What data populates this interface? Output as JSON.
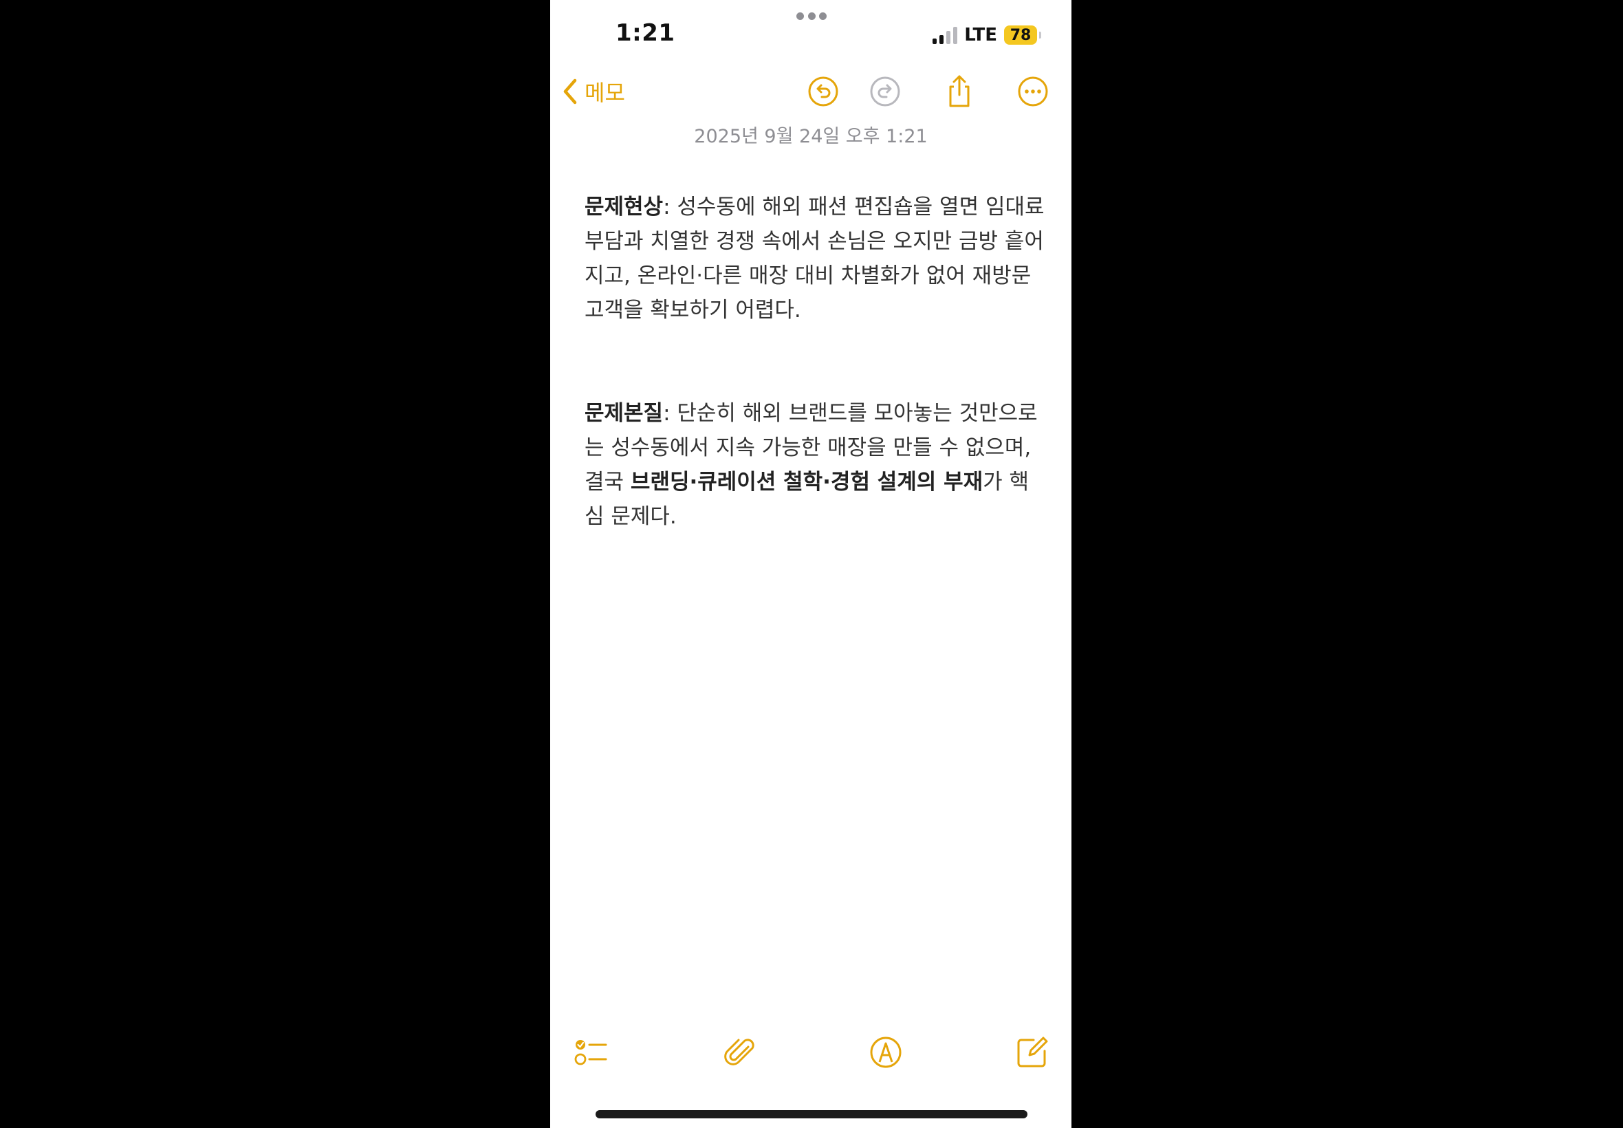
{
  "status_bar": {
    "time": "1:21",
    "network": "LTE",
    "battery": "78",
    "signal_bars_active": 2,
    "signal_bars_total": 4
  },
  "nav": {
    "back_label": "메모",
    "icons": [
      "undo-icon",
      "redo-icon",
      "share-icon",
      "more-icon"
    ]
  },
  "note": {
    "date": "2025년 9월 24일 오후 1:21",
    "para1": {
      "label": "문제현상",
      "text": ": 성수동에 해외 패션 편집숍을 열면 임대료 부담과 치열한 경쟁 속에서 손님은 오지만 금방 흩어지고, 온라인·다른 매장 대비 차별화가 없어 재방문 고객을 확보하기 어렵다."
    },
    "para2": {
      "label": "문제본질",
      "text_before": ": 단순히 해외 브랜드를 모아놓는 것만으로는 성수동에서 지속 가능한 매장을 만들 수 없으며, 결국 ",
      "bold": "브랜딩·큐레이션 철학·경험 설계의 부재",
      "text_after": "가 핵심 문제다."
    }
  },
  "toolbar": {
    "icons": [
      "checklist-icon",
      "attachment-icon",
      "markup-icon",
      "compose-icon"
    ]
  },
  "colors": {
    "accent": "#e5a50a",
    "disabled": "#b8b8bd",
    "battery": "#f4c720",
    "text": "#333333",
    "secondary": "#8e8e93"
  }
}
